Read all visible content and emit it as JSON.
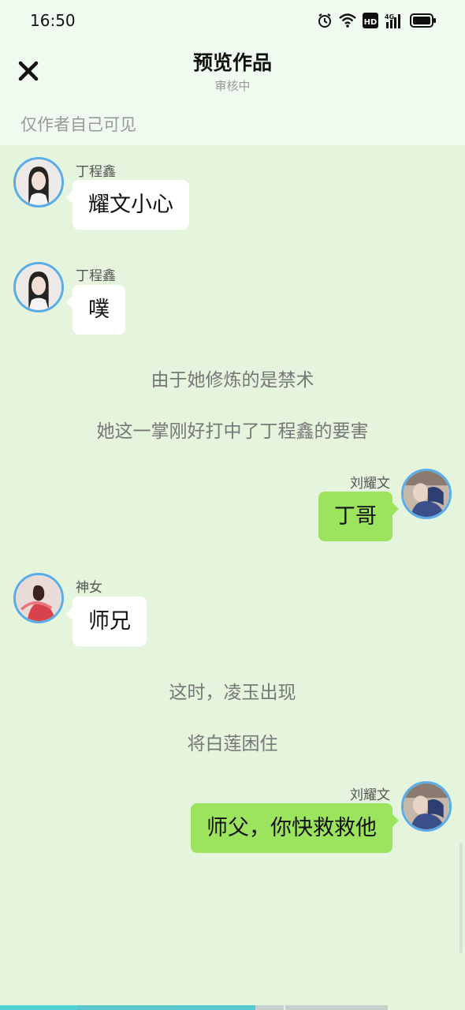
{
  "status_bar": {
    "time": "16:50",
    "icons": [
      "alarm-icon",
      "wifi-icon",
      "hd-icon",
      "signal-4g-icon",
      "battery-icon"
    ],
    "network_label": "4G",
    "hd_label": "HD"
  },
  "header": {
    "title": "预览作品",
    "subtitle": "审核中",
    "close_icon": "close-icon"
  },
  "notice": "仅作者自己可见",
  "messages": [
    {
      "type": "message",
      "side": "left",
      "sender": "丁程鑫",
      "text": "耀文小心"
    },
    {
      "type": "message",
      "side": "left",
      "sender": "丁程鑫",
      "text": "噗"
    },
    {
      "type": "narration",
      "text": "由于她修炼的是禁术"
    },
    {
      "type": "narration",
      "text": "她这一掌刚好打中了丁程鑫的要害"
    },
    {
      "type": "message",
      "side": "right",
      "sender": "刘耀文",
      "text": "丁哥"
    },
    {
      "type": "message",
      "side": "left",
      "sender": "神女",
      "text": "师兄"
    },
    {
      "type": "narration",
      "text": "这时，凌玉出现"
    },
    {
      "type": "narration",
      "text": "将白莲困住"
    },
    {
      "type": "message",
      "side": "right",
      "sender": "刘耀文",
      "text": "师父，你快救救他"
    }
  ],
  "colors": {
    "background": "#e4f4dd",
    "header_bg": "#f0fbef",
    "bubble_left": "#ffffff",
    "bubble_right": "#9ce35e",
    "avatar_ring": "#5aace8",
    "progress": [
      "#4fd3d6",
      "#5bc6cc",
      "#56c8d0",
      "#c9cfcd",
      "#c9cfcd"
    ]
  }
}
